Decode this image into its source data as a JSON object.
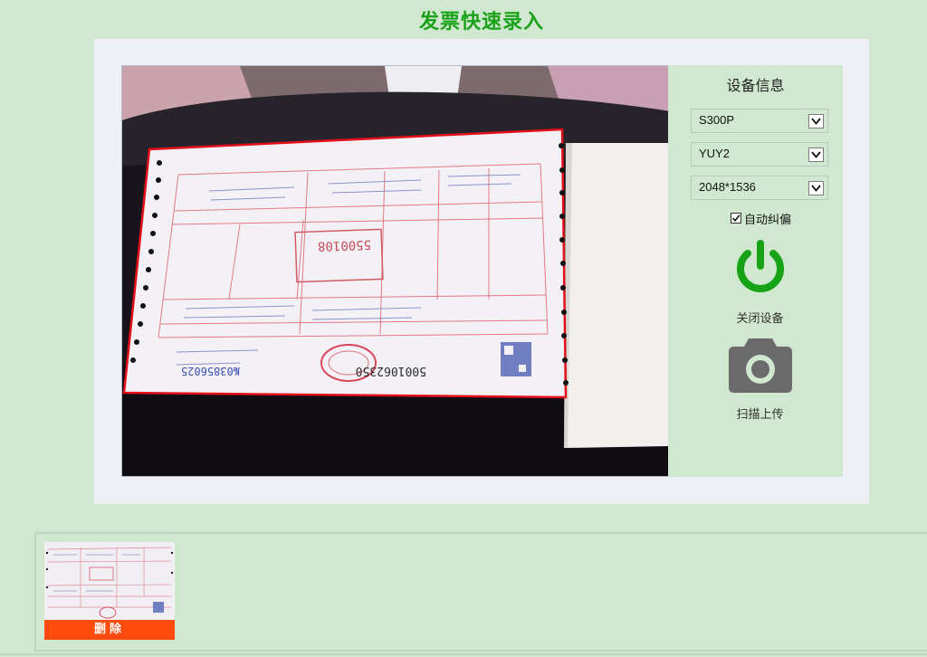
{
  "page": {
    "title": "发票快速录入"
  },
  "device": {
    "title": "设备信息",
    "device_select": {
      "value": "S300P"
    },
    "format_select": {
      "value": "YUY2"
    },
    "resolution_select": {
      "value": "2048*1536"
    },
    "auto_correct": {
      "label": "自动纠偏",
      "checked": true
    },
    "power_button": {
      "label": "关闭设备",
      "icon": "power-icon",
      "color": "#16a316"
    },
    "scan_button": {
      "label": "扫描上传",
      "icon": "camera-icon",
      "color": "#6b6b6b"
    }
  },
  "camera": {
    "crop_outline_color": "#e3101a",
    "invoice": {
      "code": "5001062350",
      "number": "03856025",
      "number_prefix": "№",
      "stamp_code": "5500108"
    }
  },
  "thumbnails": [
    {
      "delete_label": "删除"
    }
  ],
  "colors": {
    "background": "#cfe8cf",
    "title": "#1aa21a",
    "delete": "#ff4b0d"
  }
}
